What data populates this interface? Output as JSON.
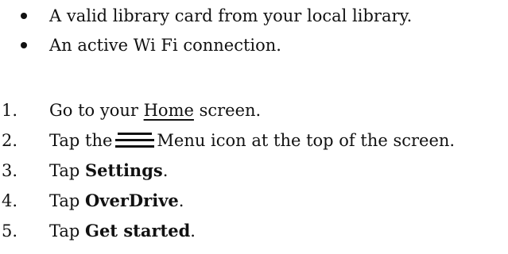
{
  "requirements": [
    "A valid library card from your local library.",
    "An active Wi Fi connection."
  ],
  "steps": [
    {
      "num": "1.",
      "before": "Go to your ",
      "underline": "Home",
      "after": " screen."
    },
    {
      "num": "2.",
      "before": "Tap the",
      "icon": "menu-icon",
      "after": "Menu icon at the top of the screen."
    },
    {
      "num": "3.",
      "before": "Tap ",
      "bold": "Settings",
      "after": "."
    },
    {
      "num": "4.",
      "before": "Tap ",
      "bold": "OverDrive",
      "after": "."
    },
    {
      "num": "5.",
      "before": "Tap ",
      "bold": "Get started",
      "after": "."
    }
  ]
}
